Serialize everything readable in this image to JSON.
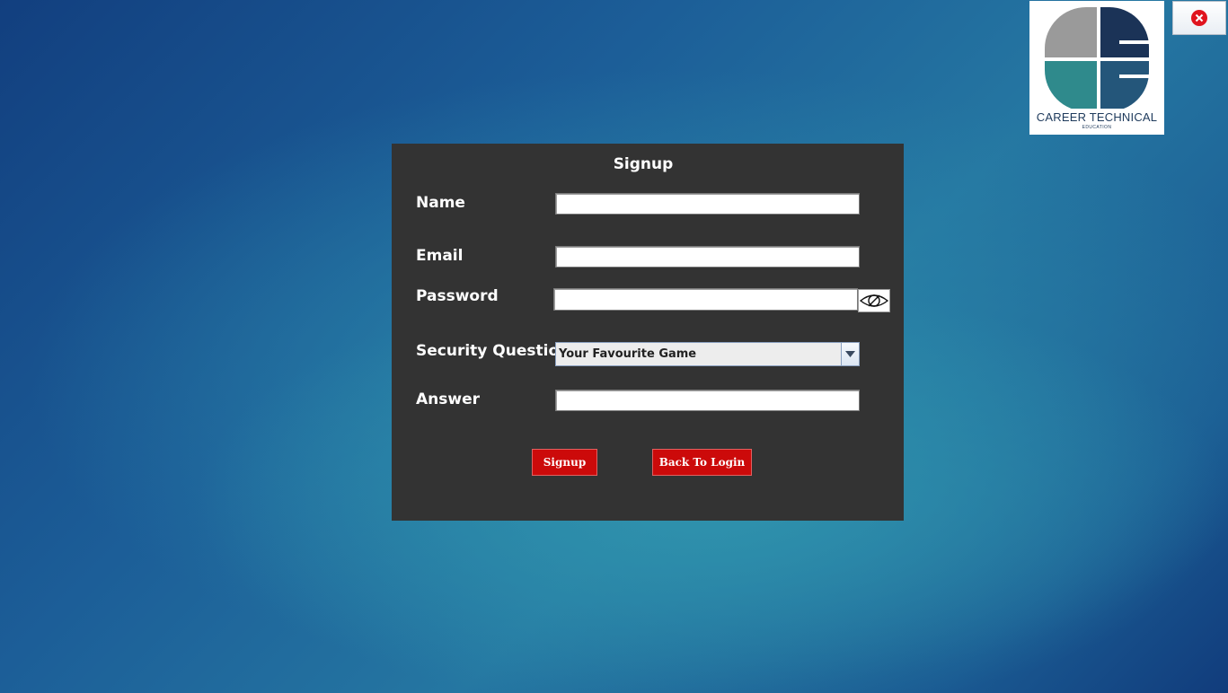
{
  "form": {
    "title": "Signup",
    "name_label": "Name",
    "name_value": "",
    "email_label": "Email",
    "email_value": "",
    "password_label": "Password",
    "password_value": "",
    "security_question_label": "Security Question",
    "security_question_selected": "Your Favourite Game",
    "answer_label": "Answer",
    "answer_value": ""
  },
  "buttons": {
    "signup": "Signup",
    "back_to_login": "Back To Login"
  },
  "logo": {
    "title": "CAREER TECHNICAL",
    "subtitle": "EDUCATION"
  },
  "icons": {
    "password_toggle": "eye-slash-icon",
    "dropdown": "chevron-down-icon",
    "close": "close-icon"
  },
  "colors": {
    "panel": "#333333",
    "button": "#cc0a0a",
    "close": "#e0141e",
    "logo_gray": "#9a9a9a",
    "logo_navy": "#1b3357",
    "logo_teal": "#2f8a8c",
    "logo_steel": "#24567a"
  }
}
